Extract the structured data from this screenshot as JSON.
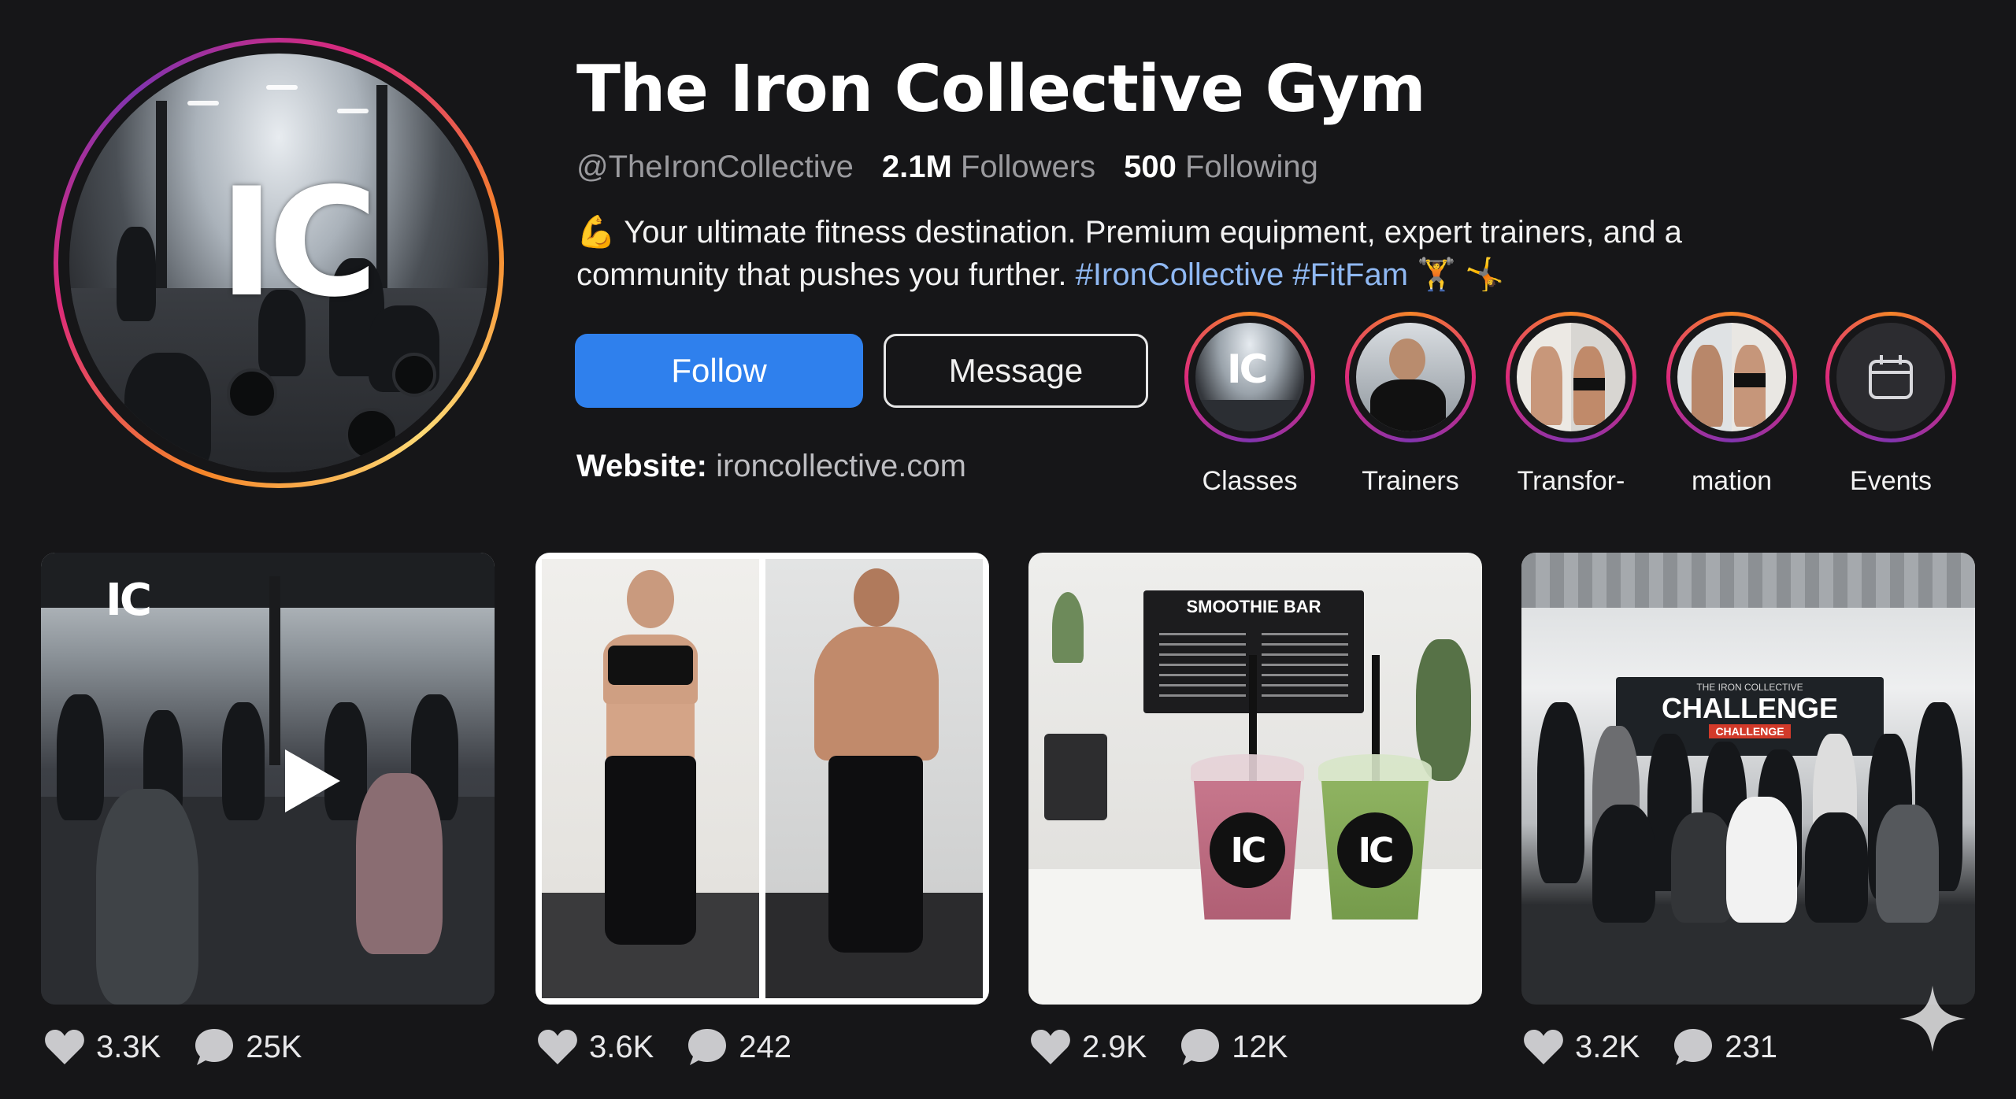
{
  "profile": {
    "name": "The Iron Collective Gym",
    "handle": "@TheIronCollective",
    "followers_count": "2.1M",
    "followers_label": "Followers",
    "following_count": "500",
    "following_label": "Following",
    "avatar_logo": "IC",
    "bio_line1": "💪 Your ultimate fitness destination. Premium equipment, expert trainers, and a",
    "bio_line2": "community that pushes you further. ",
    "bio_tags": "#IronCollective #FitFam",
    "bio_emojis": " 🏋 🤸",
    "website_label": "Website:",
    "website_url": "ironcollective.com"
  },
  "actions": {
    "follow_label": "Follow",
    "message_label": "Message"
  },
  "highlights": [
    {
      "label": "Classes",
      "icon": "gym-floor-photo"
    },
    {
      "label": "Trainers",
      "icon": "trainer-photo"
    },
    {
      "label": "Transfor-",
      "icon": "transformation-photo"
    },
    {
      "label": "mation",
      "icon": "transformation-photo"
    },
    {
      "label": "Events",
      "icon": "calendar-icon"
    }
  ],
  "posts": [
    {
      "type": "video",
      "likes": "3.3K",
      "comments": "25K",
      "icon": "play-icon"
    },
    {
      "type": "image",
      "likes": "3.6K",
      "comments": "242"
    },
    {
      "type": "image",
      "likes": "2.9K",
      "comments": "12K",
      "sign_text": "SMOOTHIE BAR",
      "cup_logo": "IC"
    },
    {
      "type": "image",
      "likes": "3.2K",
      "comments": "231",
      "banner_small": "THE IRON COLLECTIVE",
      "banner_title": "CHALLENGE",
      "banner_sub": "CHALLENGE"
    }
  ],
  "colors": {
    "background": "#161618",
    "follow_button": "#2f80ed",
    "hashtag": "#8fb8f2",
    "ring_gradient": [
      "#f58529",
      "#dd2a7b",
      "#8134af"
    ]
  }
}
